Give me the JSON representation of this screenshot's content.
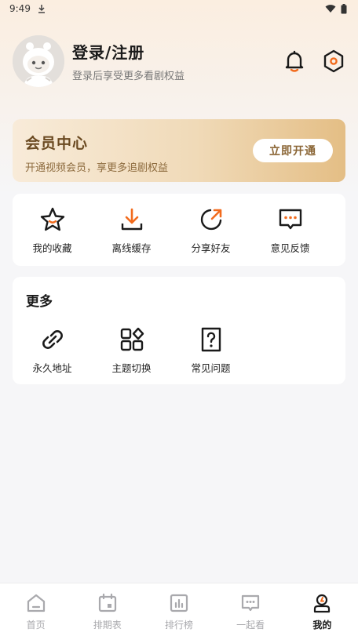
{
  "status_bar": {
    "time": "9:49"
  },
  "profile": {
    "title": "登录/注册",
    "subtitle": "登录后享受更多看剧权益"
  },
  "member": {
    "title": "会员中心",
    "subtitle": "开通视频会员，享更多追剧权益",
    "button_label": "立即开通"
  },
  "quick_actions": [
    {
      "label": "我的收藏",
      "icon": "star-icon"
    },
    {
      "label": "离线缓存",
      "icon": "download-icon"
    },
    {
      "label": "分享好友",
      "icon": "share-icon"
    },
    {
      "label": "意见反馈",
      "icon": "feedback-icon"
    }
  ],
  "more": {
    "title": "更多",
    "items": [
      {
        "label": "永久地址",
        "icon": "link-icon"
      },
      {
        "label": "主题切换",
        "icon": "theme-icon"
      },
      {
        "label": "常见问题",
        "icon": "faq-icon"
      }
    ]
  },
  "bottom_nav": [
    {
      "label": "首页",
      "icon": "home-icon",
      "active": false
    },
    {
      "label": "排期表",
      "icon": "calendar-icon",
      "active": false
    },
    {
      "label": "排行榜",
      "icon": "chart-icon",
      "active": false
    },
    {
      "label": "一起看",
      "icon": "watch-together-icon",
      "active": false
    },
    {
      "label": "我的",
      "icon": "profile-icon",
      "active": true
    }
  ],
  "colors": {
    "accent": "#f26b1d",
    "member_text": "#6b4a22",
    "nav_inactive": "#a9a9ad"
  }
}
